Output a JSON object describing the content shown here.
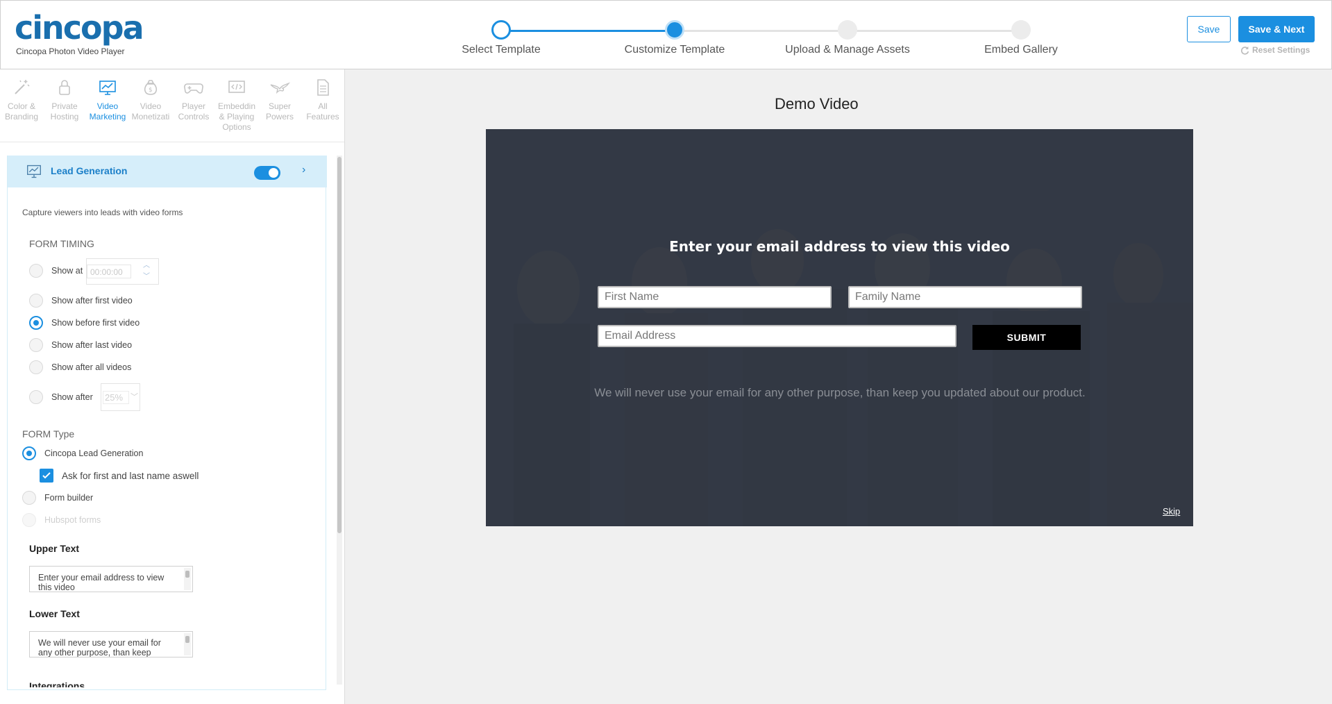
{
  "brand": {
    "logo_text": "cincopa",
    "subtitle": "Cincopa Photon Video Player"
  },
  "stepper": {
    "steps": [
      {
        "label": "Select Template",
        "state": "done"
      },
      {
        "label": "Customize Template",
        "state": "current"
      },
      {
        "label": "Upload & Manage Assets",
        "state": "todo"
      },
      {
        "label": "Embed Gallery",
        "state": "todo"
      }
    ]
  },
  "header_actions": {
    "save_label": "Save",
    "save_next_label": "Save & Next",
    "reset_label": "Reset Settings"
  },
  "feature_tabs": [
    {
      "label": "Color & Branding",
      "icon": "magic-wand-icon",
      "active": false
    },
    {
      "label": "Private Hosting",
      "icon": "lock-icon",
      "active": false
    },
    {
      "label": "Video Marketing",
      "icon": "chart-monitor-icon",
      "active": true
    },
    {
      "label": "Video Monetizati",
      "icon": "money-bag-icon",
      "active": false
    },
    {
      "label": "Player Controls",
      "icon": "gamepad-icon",
      "active": false
    },
    {
      "label": "Embeddin & Playing Options",
      "icon": "code-icon",
      "active": false
    },
    {
      "label": "Super Powers",
      "icon": "eagle-icon",
      "active": false
    },
    {
      "label": "All Features",
      "icon": "document-icon",
      "active": false
    }
  ],
  "lead_generation": {
    "title": "Lead Generation",
    "enabled": true,
    "description": "Capture viewers into leads with video forms",
    "form_timing_label": "FORM TIMING",
    "timing_options": {
      "show_at": "Show at",
      "show_at_value": "00:00:00",
      "after_first": "Show after first video",
      "before_first": "Show before first video",
      "after_last": "Show after last video",
      "after_all": "Show after all videos",
      "show_after": "Show after",
      "show_after_value": "25%"
    },
    "selected_timing": "before_first",
    "form_type_label": "FORM Type",
    "form_types": {
      "cincopa": "Cincopa Lead Generation",
      "ask_names": "Ask for first and last name aswell",
      "form_builder": "Form builder",
      "hubspot": "Hubspot forms"
    },
    "upper_text_label": "Upper Text",
    "upper_text_value": "Enter your email address to view this video",
    "lower_text_label": "Lower Text",
    "lower_text_value": "We will never use your email for any other purpose, than keep",
    "integrations_label": "Integrations"
  },
  "preview": {
    "title": "Demo Video",
    "form_title": "Enter your email address to view this video",
    "first_name_placeholder": "First Name",
    "family_name_placeholder": "Family Name",
    "email_placeholder": "Email Address",
    "submit_label": "SUBMIT",
    "lower_text": "We will never use your email for any other purpose, than keep you updated about our product.",
    "skip_label": "Skip"
  },
  "colors": {
    "accent": "#1b8fe0",
    "panel_header": "#d6eefa",
    "video_overlay": "#2c323e"
  }
}
